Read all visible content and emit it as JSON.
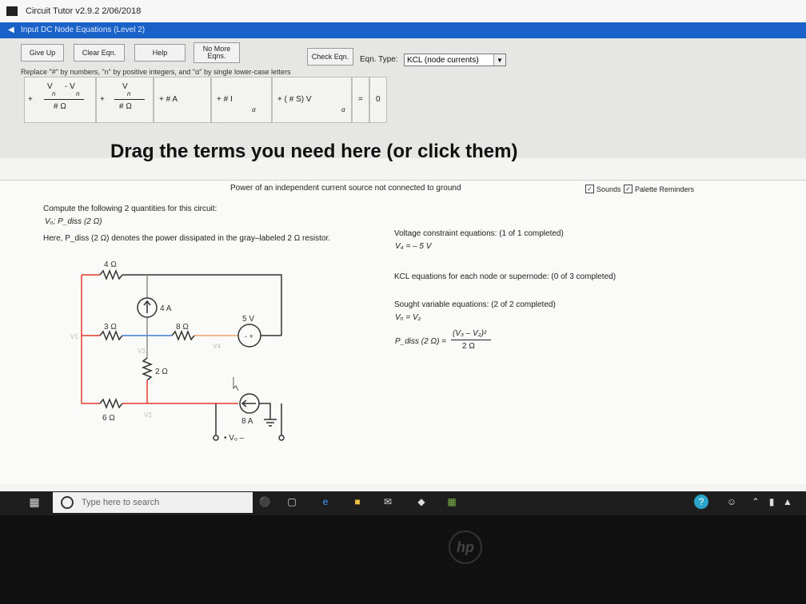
{
  "window": {
    "title": "Circuit Tutor v2.9.2  2/06/2018",
    "mode_title": "Input DC Node Equations (Level 2)"
  },
  "toolbar": {
    "give_up": "Give Up",
    "clear_eqn": "Clear Eqn.",
    "help": "Help",
    "no_more_eqns": "No More Eqns.",
    "check_eqn": "Check Eqn.",
    "eqn_type_label": "Eqn. Type:",
    "eqn_type_value": "KCL (node currents)",
    "hint": "Replace \"#\" by numbers, \"n\" by positive integers, and \"α\" by single lower-case letters"
  },
  "tiles": {
    "t1": {
      "plus": "+",
      "v": "V",
      "minus": "- V",
      "n1": "n",
      "n2": "n",
      "den": "# Ω"
    },
    "t2": {
      "plus": "+",
      "v": "V",
      "n": "n",
      "den": "# Ω"
    },
    "t3": {
      "text": "+   #  A"
    },
    "t4": {
      "text": "+   #  I",
      "sub": "α"
    },
    "t5": {
      "text": "+ (  #  S) V",
      "sub": "α"
    },
    "t6": {
      "text": "="
    },
    "t7": {
      "text": "0"
    }
  },
  "drag_hint": "Drag the terms you need here (or click them)",
  "status_line": "Power of an independent current source not connected to ground",
  "checkboxes": {
    "sounds": "Sounds",
    "palette": "Palette Reminders"
  },
  "problem": {
    "line1": "Compute the following 2 quantities for this circuit:",
    "line2": "Vₒ;  P_diss (2 Ω)",
    "line3": "Here, P_diss (2 Ω) denotes the power dissipated in the gray–labeled 2 Ω resistor."
  },
  "circuit": {
    "r_top": "4 Ω",
    "r_3": "3 Ω",
    "r_8": "8 Ω",
    "r_2": "2 Ω",
    "r_6": "6 Ω",
    "cs_4": "4 A",
    "vs_5": "5 V",
    "cs_8": "8 A",
    "n1": "V1",
    "n2": "V2",
    "n3": "V3",
    "n4": "V4",
    "vo": "•  Vₒ  –"
  },
  "progress": {
    "vc_title": "Voltage constraint equations:  (1 of 1 completed)",
    "vc_eq": "V₄ = – 5 V",
    "kcl_title": "KCL equations for each node or supernode:  (0 of 3 completed)",
    "sought_title": "Sought variable equations:  (2 of 2 completed)",
    "sought_eq1": "Vₒ = V₂",
    "sought_eq2_lhs": "P_diss (2 Ω) =",
    "sought_eq2_num": "(V₃ – V₂)²",
    "sought_eq2_den": "2 Ω"
  },
  "taskbar": {
    "search_placeholder": "Type here to search"
  },
  "bezel": {
    "logo": "hp"
  },
  "colors": {
    "modebar": "#1b62c8",
    "wire_red": "#e23a2a",
    "wire_blue": "#3b7ad9",
    "wire_gray": "#8a8a8a"
  }
}
